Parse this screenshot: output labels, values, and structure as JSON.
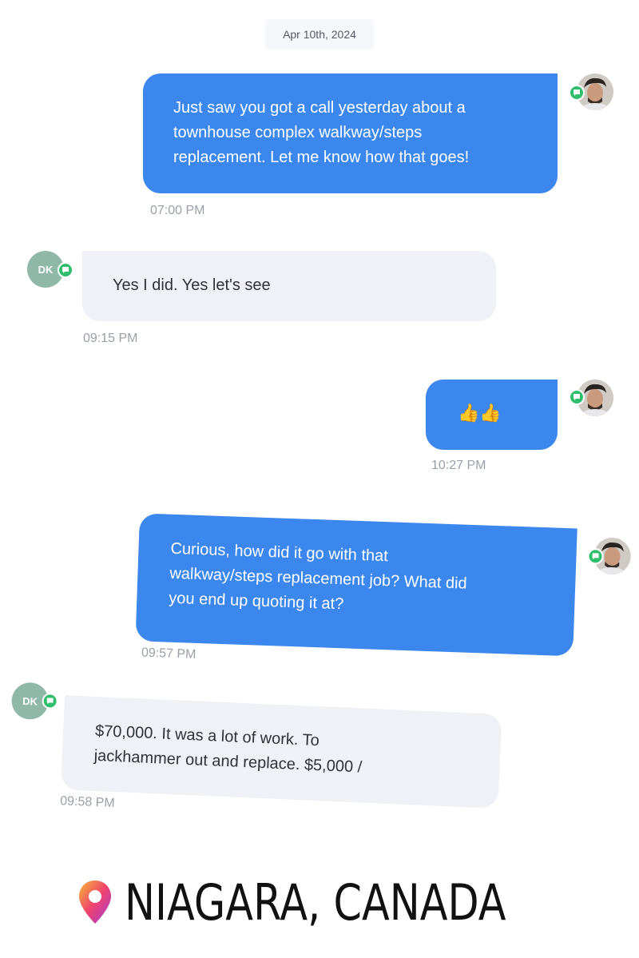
{
  "date_label": "Apr 10th, 2024",
  "messages": [
    {
      "direction": "outgoing",
      "lines": [
        "Just saw you got a call yesterday about a",
        "townhouse complex walkway/steps",
        "replacement. Let me know how that goes!"
      ],
      "time": "07:00 PM"
    },
    {
      "direction": "incoming",
      "sender_initials": "DK",
      "lines": [
        "Yes I did. Yes let's see"
      ],
      "time": "09:15 PM"
    },
    {
      "direction": "outgoing",
      "lines": [
        "👍👍"
      ],
      "time": "10:27 PM"
    },
    {
      "direction": "outgoing",
      "lines": [
        "Curious, how did it go with that",
        "walkway/steps replacement job? What did",
        "you end up quoting it at?"
      ],
      "time": "09:57 PM"
    },
    {
      "direction": "incoming",
      "sender_initials": "DK",
      "lines": [
        "$70,000. It was a lot of work. To",
        "jackhammer out and replace. $5,000 /"
      ],
      "time": "09:58 PM"
    }
  ],
  "location": {
    "text": "NIAGARA, CANADA",
    "icon": "location-pin-icon"
  },
  "colors": {
    "outgoing_bubble": "#3b87ee",
    "incoming_bubble": "#f0f1f7",
    "dk_avatar": "#8fb8a6",
    "sms_badge": "#2fbf6c"
  }
}
